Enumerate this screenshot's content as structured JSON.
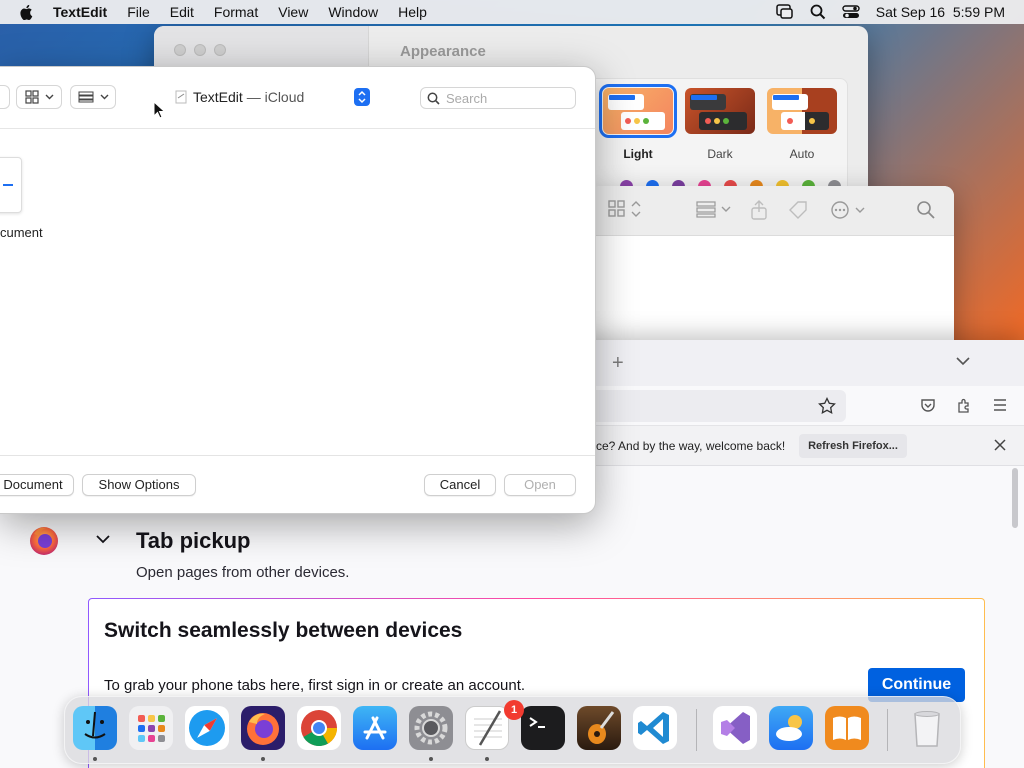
{
  "menubar": {
    "app_name": "TextEdit",
    "items": [
      "File",
      "Edit",
      "Format",
      "View",
      "Window",
      "Help"
    ],
    "datetime": "Sat Sep 16  5:59 PM"
  },
  "settings_window": {
    "section_title": "Appearance",
    "themes": [
      {
        "label": "Light",
        "selected": true
      },
      {
        "label": "Dark",
        "selected": false
      },
      {
        "label": "Auto",
        "selected": false
      }
    ],
    "accent_colors": [
      "#8e44ad",
      "#1d6ff2",
      "#7b3fa0",
      "#e84393",
      "#e84a4a",
      "#e8891d",
      "#f2c12e",
      "#5bb33b",
      "#8e8e93"
    ]
  },
  "open_dialog": {
    "location_app": "TextEdit",
    "location_separator": " — ",
    "location_place": "iCloud",
    "search_placeholder": "Search",
    "document_label": "cument",
    "buttons": {
      "new_document": "Document",
      "show_options": "Show Options",
      "cancel": "Cancel",
      "open": "Open"
    }
  },
  "firefox": {
    "notice_text": "ce? And by the way, welcome back!",
    "notice_button": "Refresh Firefox...",
    "tab_pickup_title": "Tab pickup",
    "tab_pickup_subtitle": "Open pages from other devices.",
    "card_title": "Switch seamlessly between devices",
    "card_text": "To grab your phone tabs here, first sign in or create an account.",
    "continue_label": "Continue"
  },
  "dock": {
    "settings_badge": "1",
    "apps": [
      "finder-icon",
      "launchpad-icon",
      "safari-icon",
      "firefox-icon",
      "chrome-icon",
      "app-store-icon",
      "system-settings-icon",
      "textedit-icon",
      "terminal-icon",
      "garageband-icon",
      "vscode-icon",
      "visual-studio-icon",
      "weather-icon",
      "books-icon",
      "trash-icon"
    ]
  }
}
